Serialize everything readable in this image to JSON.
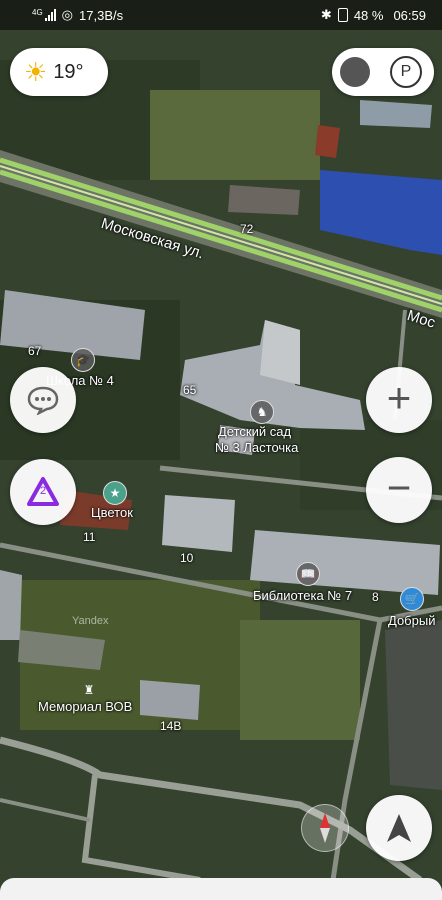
{
  "status": {
    "network": "4G",
    "speed": "17,3B/s",
    "battery": "48 %",
    "time": "06:59"
  },
  "weather": {
    "temperature": "19°",
    "icon": "sun-icon"
  },
  "parking_icon_label": "P",
  "map": {
    "street_label": "Московская ул.",
    "street_label_cut": "Мос",
    "watermark": "Yandex",
    "house_numbers": [
      "72",
      "67",
      "65",
      "11",
      "10",
      "8",
      "14В"
    ],
    "pois": [
      {
        "name": "Школа № 4",
        "icon": "school-icon"
      },
      {
        "name": "Детский сад\n№ 3 Ласточка",
        "line1": "Детский сад",
        "line2": "№ 3 Ласточка",
        "icon": "rocking-horse-icon"
      },
      {
        "name": "Цветок",
        "icon": "star-icon"
      },
      {
        "name": "Библиотека № 7",
        "icon": "book-icon"
      },
      {
        "name": "Добрый",
        "icon": "basket-icon"
      },
      {
        "name": "Мемориал ВОВ",
        "icon": "monument-icon"
      }
    ]
  },
  "controls": {
    "zoom_in": "+",
    "zoom_out": "−",
    "assistant_badge": "2"
  },
  "colors": {
    "route": "#9fd36a",
    "water_roof": "#2d4fb0"
  }
}
